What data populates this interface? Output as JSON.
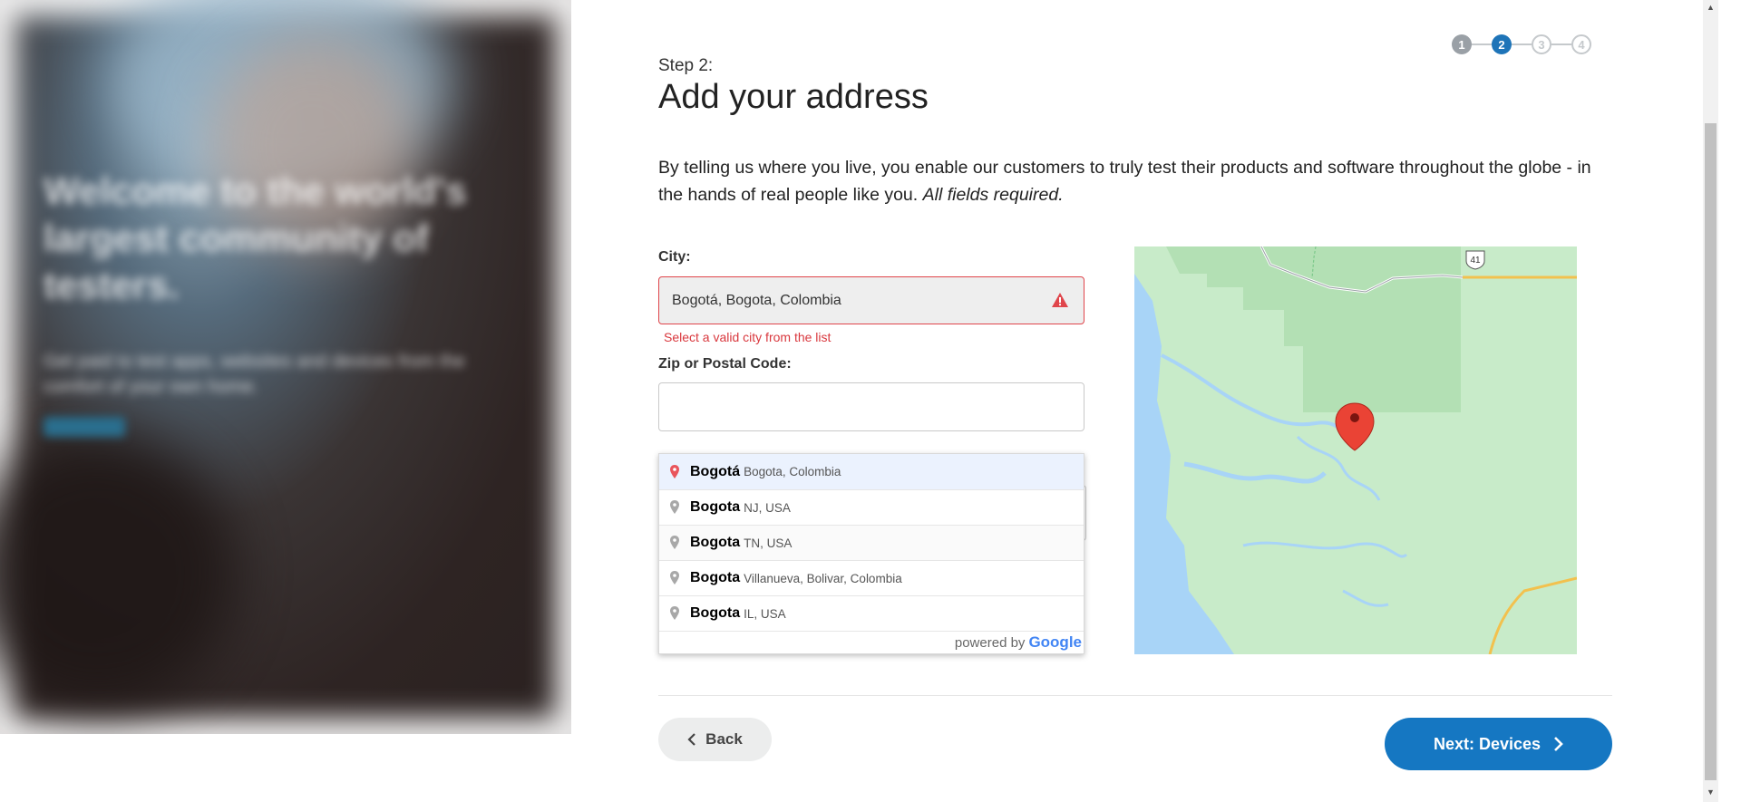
{
  "hero": {
    "title": "Welcome to the world's largest community of testers.",
    "subtitle": "Get paid to test apps, websites and devices from the comfort of your own home."
  },
  "stepper": {
    "steps": [
      "1",
      "2",
      "3",
      "4"
    ],
    "current": 2
  },
  "step_label": "Step 2:",
  "title": "Add your address",
  "intro": "By telling us where you live, you enable our customers to truly test their products and software throughout the globe - in the hands of real people like you.",
  "intro_emphasis": "All fields required.",
  "city": {
    "label": "City:",
    "value": "Bogotá, Bogota, Colombia",
    "error": "Select a valid city from the list"
  },
  "zip": {
    "label": "Zip or Postal Code:",
    "value": ""
  },
  "autocomplete": {
    "items": [
      {
        "match": "Bogotá",
        "rest": "Bogota, Colombia"
      },
      {
        "match": "Bogota",
        "rest": "NJ, USA"
      },
      {
        "match": "Bogota",
        "rest": "TN, USA"
      },
      {
        "match": "Bogota",
        "rest": "Villanueva, Bolivar, Colombia"
      },
      {
        "match": "Bogota",
        "rest": "IL, USA"
      }
    ],
    "footer_text": "powered by",
    "footer_brand": "Google"
  },
  "map": {
    "highway_shield": "41"
  },
  "buttons": {
    "back": "Back",
    "next": "Next: Devices"
  },
  "colors": {
    "primary": "#1577c2",
    "error": "#d9383e",
    "map_land": "#c8ebc9",
    "map_park": "#b3e0b4",
    "map_water": "#a8d4f7"
  }
}
